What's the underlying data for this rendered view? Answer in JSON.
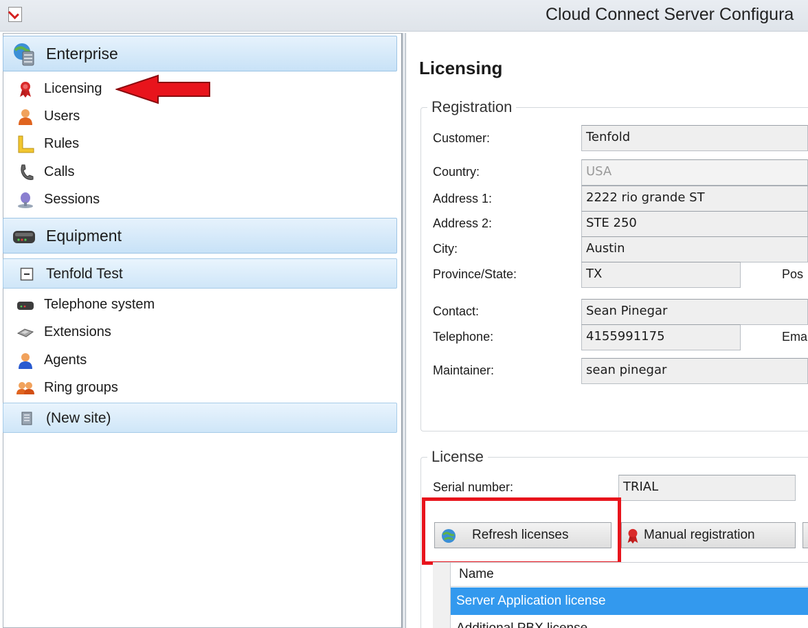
{
  "window": {
    "title": "Cloud Connect Server Configura"
  },
  "sidebar": {
    "enterprise": {
      "label": "Enterprise",
      "items": [
        {
          "label": "Licensing",
          "icon": "ribbon-icon"
        },
        {
          "label": "Users",
          "icon": "user-icon"
        },
        {
          "label": "Rules",
          "icon": "ruler-icon"
        },
        {
          "label": "Calls",
          "icon": "phone-handset-icon"
        },
        {
          "label": "Sessions",
          "icon": "session-icon"
        }
      ]
    },
    "equipment": {
      "label": "Equipment"
    },
    "site": {
      "label": "Tenfold Test",
      "items": [
        {
          "label": "Telephone system",
          "icon": "pbx-icon"
        },
        {
          "label": "Extensions",
          "icon": "extensions-icon"
        },
        {
          "label": "Agents",
          "icon": "agent-icon"
        },
        {
          "label": "Ring groups",
          "icon": "ring-group-icon"
        }
      ]
    },
    "new_site": {
      "label": "(New site)"
    }
  },
  "main": {
    "title": "Licensing",
    "registration": {
      "title": "Registration",
      "customer_label": "Customer:",
      "customer_value": "Tenfold",
      "country_label": "Country:",
      "country_value": "USA",
      "address1_label": "Address 1:",
      "address1_value": "2222 rio grande ST",
      "address2_label": "Address 2:",
      "address2_value": "STE 250",
      "city_label": "City:",
      "city_value": "Austin",
      "state_label": "Province/State:",
      "state_value": "TX",
      "postal_label": "Pos",
      "contact_label": "Contact:",
      "contact_value": "Sean Pinegar",
      "telephone_label": "Telephone:",
      "telephone_value": "4155991175",
      "email_label": "Ema",
      "maintainer_label": "Maintainer:",
      "maintainer_value": "sean pinegar"
    },
    "license": {
      "title": "License",
      "serial_label": "Serial number:",
      "serial_value": "TRIAL",
      "refresh_button": "Refresh licenses",
      "manual_button": "Manual registration",
      "grid_header": "Name",
      "rows": [
        "Server Application license",
        "Additional PBX license"
      ]
    }
  },
  "colors": {
    "accent": "#3399ee",
    "highlight": "#e8141c",
    "arrow": "#e8141c"
  }
}
